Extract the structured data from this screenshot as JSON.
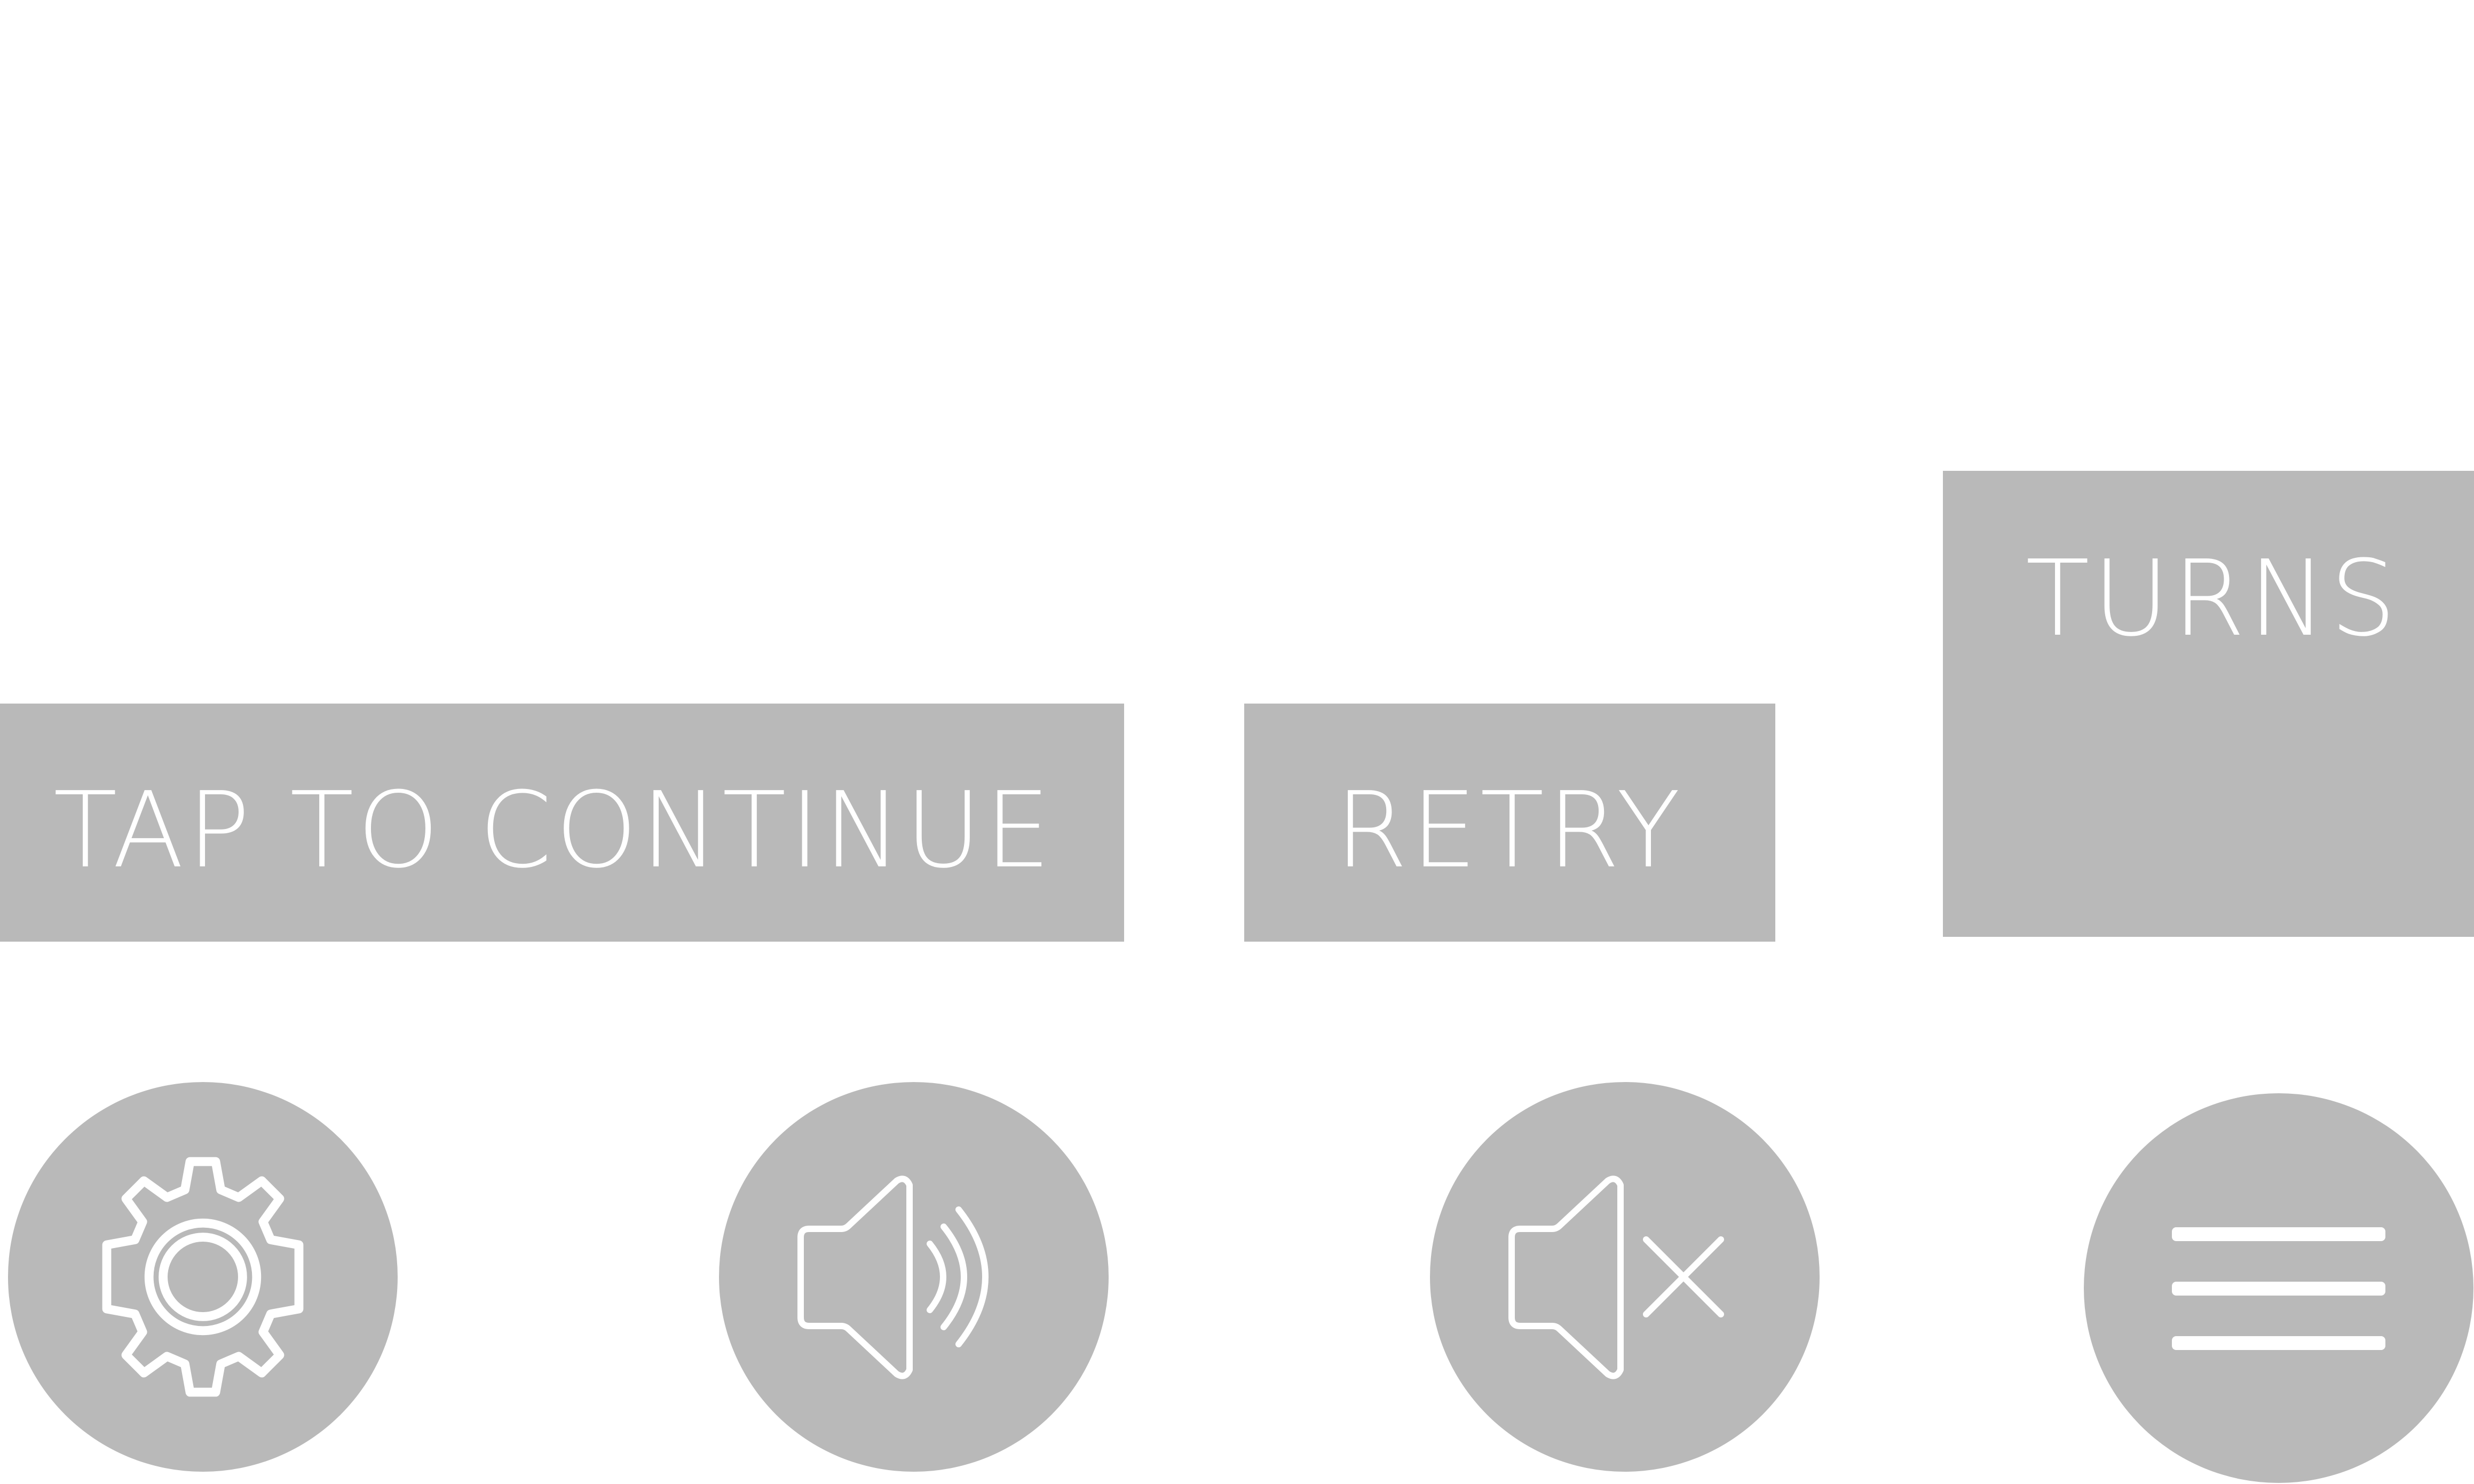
{
  "buttons": {
    "tap_to_continue": "TAP TO CONTINUE",
    "retry": "RETRY"
  },
  "turns_panel": {
    "label": "TURNS"
  },
  "icon_buttons": [
    {
      "name": "settings",
      "icon": "gear-icon"
    },
    {
      "name": "sound-on",
      "icon": "speaker-sound-on-icon"
    },
    {
      "name": "sound-off",
      "icon": "speaker-muted-icon"
    },
    {
      "name": "menu",
      "icon": "hamburger-menu-icon"
    }
  ],
  "colors": {
    "panel": "#b9b9b9",
    "text": "#ffffff",
    "background": "#ffffff"
  }
}
